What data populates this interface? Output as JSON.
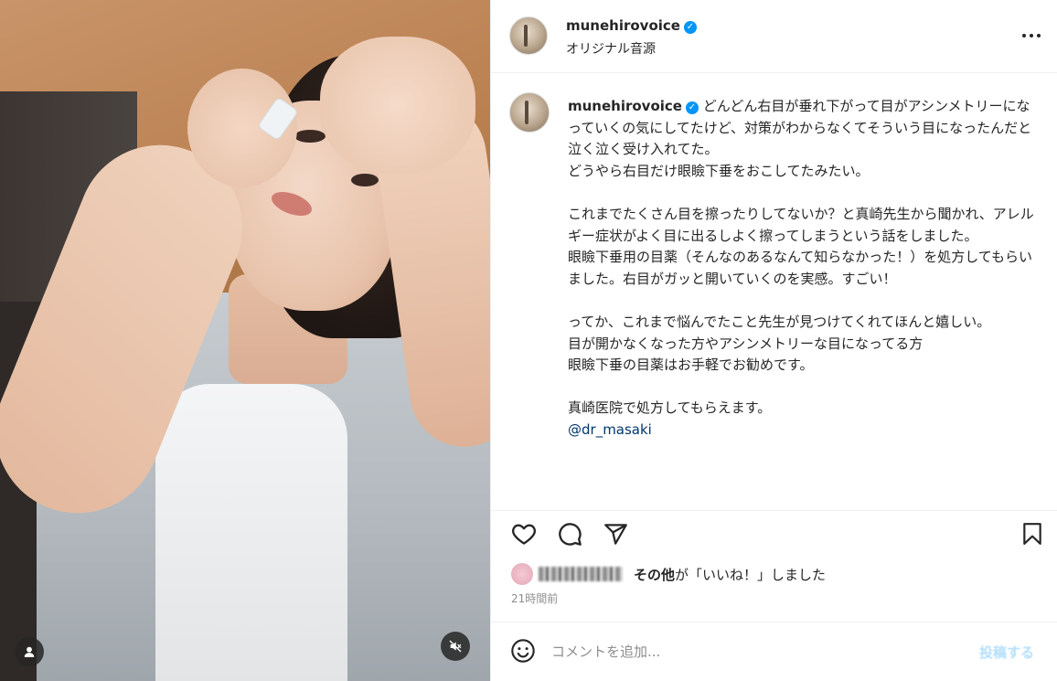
{
  "colors": {
    "accent": "#0095f6",
    "text": "#262626",
    "secondary_text": "#8e8e8e",
    "mention": "#00376b",
    "divider": "#efefef"
  },
  "media": {
    "user_tag_icon": "person-icon",
    "mute_icon": "muted-speaker-icon"
  },
  "header": {
    "username": "munehirovoice",
    "verified_icon": "verified-badge-icon",
    "subtitle": "オリジナル音源",
    "more_icon": "more-horizontal-icon"
  },
  "caption": {
    "username": "munehirovoice",
    "lines": [
      "どんどん右目が垂れ下がって目がアシンメトリーになっていくの気にしてたけど、対策がわからなくてそういう目になったんだと泣く泣く受け入れてた。",
      "どうやら右目だけ眼瞼下垂をおこしてたみたい。",
      "",
      "これまでたくさん目を擦ったりしてないか？と真崎先生から聞かれ、アレルギー症状がよく目に出るしよく擦ってしまうという話をしました。",
      "眼瞼下垂用の目薬（そんなのあるなんて知らなかった！）を処方してもらいました。右目がガッと開いていくのを実感。すごい！",
      "",
      "ってか、これまで悩んでたこと先生が見つけてくれてほんと嬉しい。",
      "目が開かなくなった方やアシンメトリーな目になってる方",
      "眼瞼下垂の目薬はお手軽でお勧めです。",
      "",
      "真崎医院で処方してもらえます。"
    ],
    "mention": "@dr_masaki"
  },
  "actions": {
    "like_icon": "heart-icon",
    "comment_icon": "comment-bubble-icon",
    "share_icon": "paper-plane-icon",
    "save_icon": "bookmark-icon"
  },
  "likes": {
    "others": "その他",
    "suffix": "が「いいね！」しました"
  },
  "timestamp": "21時間前",
  "comment_box": {
    "emoji_icon": "smiley-icon",
    "placeholder": "コメントを追加...",
    "post_label": "投稿する"
  }
}
